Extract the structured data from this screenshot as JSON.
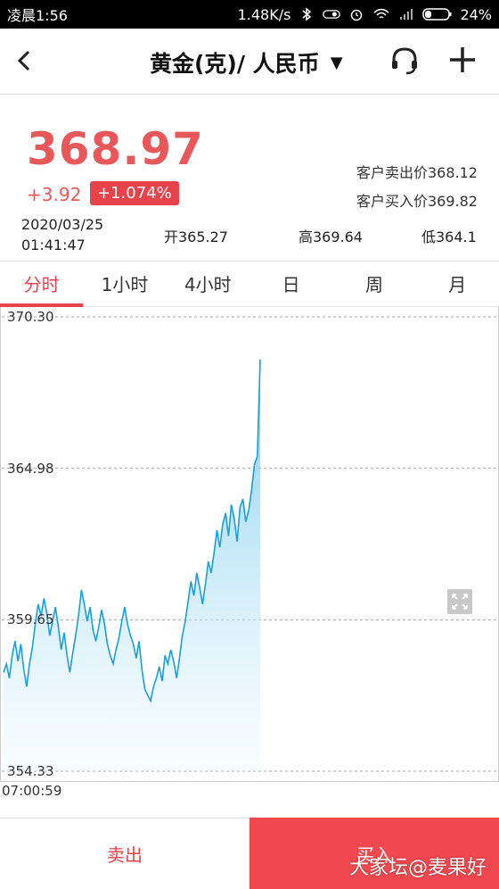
{
  "status_bar": {
    "time": "凌晨1:56",
    "speed": "1.48K/s",
    "battery": "24%"
  },
  "nav": {
    "title": "黄金(克)/ 人民币",
    "caret": "▼",
    "back_icon": "chevron-left-icon",
    "service_icon": "headset-icon",
    "add_icon": "plus-icon"
  },
  "quote": {
    "price": "368.97",
    "change": "+3.92",
    "change_pct": "+1.074%",
    "sell_price": "客户卖出价368.12",
    "buy_price": "客户买入价369.82",
    "date": "2020/03/25",
    "time": "01:41:47",
    "open": "开365.27",
    "high": "高369.64",
    "low": "低364.1"
  },
  "tabs": [
    "分时",
    "1小时",
    "4小时",
    "日",
    "周",
    "月"
  ],
  "active_tab": 0,
  "colors": {
    "accent": "#e8434a",
    "price": "#e8585b",
    "line": "#1a9fd9"
  },
  "chart_data": {
    "type": "area",
    "ylim": [
      354.33,
      370.3
    ],
    "y_ticks": [
      "370.30",
      "364.98",
      "359.65",
      "354.33"
    ],
    "x_start_label": "07:00:59",
    "values": [
      357.8,
      358.1,
      357.6,
      358.4,
      358.9,
      358.2,
      358.8,
      357.9,
      357.3,
      358.1,
      358.7,
      359.5,
      360.2,
      359.8,
      360.4,
      359.9,
      359.1,
      359.6,
      360.1,
      359.4,
      358.6,
      359.2,
      358.4,
      357.8,
      358.5,
      359.1,
      359.8,
      360.7,
      360.2,
      359.6,
      360.1,
      359.3,
      358.9,
      359.4,
      360.0,
      359.5,
      358.8,
      358.4,
      358.1,
      358.6,
      359.0,
      359.6,
      360.1,
      359.5,
      359.1,
      358.8,
      358.3,
      358.9,
      357.9,
      357.2,
      357.0,
      356.8,
      357.3,
      357.6,
      358.0,
      357.5,
      358.4,
      358.1,
      358.6,
      358.2,
      357.6,
      358.3,
      359.1,
      359.6,
      360.3,
      361.0,
      360.5,
      361.3,
      360.8,
      360.2,
      360.9,
      361.7,
      361.3,
      362.0,
      362.8,
      362.2,
      363.0,
      363.4,
      362.6,
      363.7,
      363.2,
      362.4,
      363.6,
      363.9,
      363.1,
      363.5,
      364.2,
      365.1,
      365.4,
      368.8
    ]
  },
  "buttons": {
    "sell": "卖出",
    "buy": "买入"
  },
  "watermark": "大家坛@麦果好"
}
